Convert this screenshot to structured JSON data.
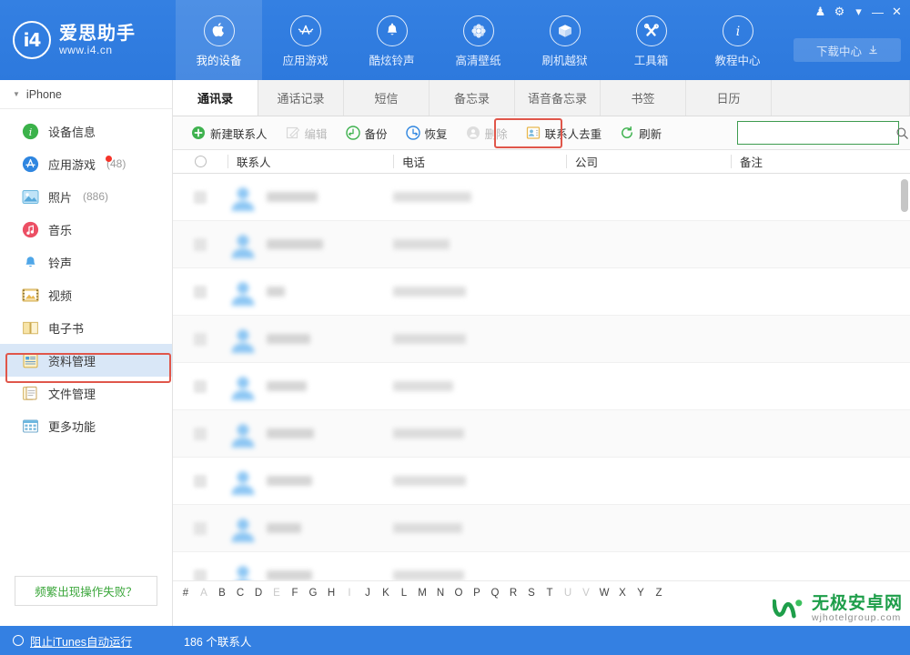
{
  "app": {
    "brand_name": "爱思助手",
    "brand_url": "www.i4.cn",
    "brand_logo_text": "i4"
  },
  "window_controls": [
    {
      "name": "skin-icon",
      "glyph": "♟"
    },
    {
      "name": "gear-icon",
      "glyph": "⚙"
    },
    {
      "name": "chevron-down-icon",
      "glyph": "▾"
    },
    {
      "name": "minimize-icon",
      "glyph": "—"
    },
    {
      "name": "close-icon",
      "glyph": "✕"
    }
  ],
  "header": {
    "download_center_label": "下载中心",
    "nav": [
      {
        "label": "我的设备",
        "icon": "apple-icon",
        "active": true
      },
      {
        "label": "应用游戏",
        "icon": "appstore-icon",
        "active": false
      },
      {
        "label": "酷炫铃声",
        "icon": "bell-icon",
        "active": false
      },
      {
        "label": "高清壁纸",
        "icon": "flower-icon",
        "active": false
      },
      {
        "label": "刷机越狱",
        "icon": "box-icon",
        "active": false
      },
      {
        "label": "工具箱",
        "icon": "tools-icon",
        "active": false
      },
      {
        "label": "教程中心",
        "icon": "info-icon",
        "active": false
      }
    ]
  },
  "sidebar": {
    "device_label": "iPhone",
    "items": [
      {
        "label": "设备信息",
        "icon": "info-circle-icon",
        "color": "#3bb24a",
        "count": "",
        "badge": false,
        "selected": false
      },
      {
        "label": "应用游戏",
        "icon": "appstore-circle-icon",
        "color": "#2f86e0",
        "count": "(48)",
        "badge": true,
        "selected": false
      },
      {
        "label": "照片",
        "icon": "photo-icon",
        "color": "#56b6e8",
        "count": "(886)",
        "badge": false,
        "selected": false
      },
      {
        "label": "音乐",
        "icon": "music-icon",
        "color": "#ec4f64",
        "count": "",
        "badge": false,
        "selected": false
      },
      {
        "label": "铃声",
        "icon": "ringtone-icon",
        "color": "#4fa6e8",
        "count": "",
        "badge": false,
        "selected": false
      },
      {
        "label": "视频",
        "icon": "video-icon",
        "color": "#e8b84f",
        "count": "",
        "badge": false,
        "selected": false
      },
      {
        "label": "电子书",
        "icon": "book-icon",
        "color": "#f0c24a",
        "count": "",
        "badge": false,
        "selected": false
      },
      {
        "label": "资料管理",
        "icon": "data-manage-icon",
        "color": "#f0c24a",
        "count": "",
        "badge": false,
        "selected": true
      },
      {
        "label": "文件管理",
        "icon": "file-manage-icon",
        "color": "#e8c87a",
        "count": "",
        "badge": false,
        "selected": false
      },
      {
        "label": "更多功能",
        "icon": "more-icon",
        "color": "#6fb8e0",
        "count": "",
        "badge": false,
        "selected": false
      }
    ],
    "help_link": "频繁出现操作失败？"
  },
  "main": {
    "tabs": [
      {
        "label": "通讯录",
        "active": true
      },
      {
        "label": "通话记录",
        "active": false
      },
      {
        "label": "短信",
        "active": false
      },
      {
        "label": "备忘录",
        "active": false
      },
      {
        "label": "语音备忘录",
        "active": false
      },
      {
        "label": "书签",
        "active": false
      },
      {
        "label": "日历",
        "active": false
      }
    ],
    "toolbar": [
      {
        "label": "新建联系人",
        "icon": "plus-circle-icon",
        "color": "#3fb24f",
        "disabled": false,
        "highlighted": false
      },
      {
        "label": "编辑",
        "icon": "edit-icon",
        "color": "#bdbdbd",
        "disabled": true,
        "highlighted": false
      },
      {
        "label": "备份",
        "icon": "backup-icon",
        "color": "#3fb24f",
        "disabled": false,
        "highlighted": true
      },
      {
        "label": "恢复",
        "icon": "restore-icon",
        "color": "#2f86e0",
        "disabled": false,
        "highlighted": false
      },
      {
        "label": "删除",
        "icon": "delete-icon",
        "color": "#c6c6c6",
        "disabled": true,
        "highlighted": false
      },
      {
        "label": "联系人去重",
        "icon": "dedupe-icon",
        "color": "#e8b84f",
        "disabled": false,
        "highlighted": false
      },
      {
        "label": "刷新",
        "icon": "refresh-icon",
        "color": "#3fb24f",
        "disabled": false,
        "highlighted": false
      }
    ],
    "search": {
      "value": "",
      "placeholder": "",
      "icon": "search-icon",
      "border_color": "#3d9b4f"
    },
    "table": {
      "columns": [
        "联系人",
        "电话",
        "公司",
        "备注"
      ],
      "select_all_icon": "select-all-circle-icon",
      "rows": [
        {
          "name_w": 56,
          "phone_w": 86,
          "company": "",
          "note": ""
        },
        {
          "name_w": 62,
          "phone_w": 62,
          "company": "",
          "note": ""
        },
        {
          "name_w": 20,
          "phone_w": 80,
          "company": "",
          "note": ""
        },
        {
          "name_w": 48,
          "phone_w": 80,
          "company": "",
          "note": ""
        },
        {
          "name_w": 44,
          "phone_w": 66,
          "company": "",
          "note": ""
        },
        {
          "name_w": 52,
          "phone_w": 78,
          "company": "",
          "note": ""
        },
        {
          "name_w": 50,
          "phone_w": 80,
          "company": "",
          "note": ""
        },
        {
          "name_w": 38,
          "phone_w": 76,
          "company": "",
          "note": ""
        },
        {
          "name_w": 50,
          "phone_w": 78,
          "company": "",
          "note": ""
        }
      ]
    },
    "alphabet": [
      {
        "ch": "#",
        "dim": false
      },
      {
        "ch": "A",
        "dim": true
      },
      {
        "ch": "B",
        "dim": false
      },
      {
        "ch": "C",
        "dim": false
      },
      {
        "ch": "D",
        "dim": false
      },
      {
        "ch": "E",
        "dim": true
      },
      {
        "ch": "F",
        "dim": false
      },
      {
        "ch": "G",
        "dim": false
      },
      {
        "ch": "H",
        "dim": false
      },
      {
        "ch": "I",
        "dim": true
      },
      {
        "ch": "J",
        "dim": false
      },
      {
        "ch": "K",
        "dim": false
      },
      {
        "ch": "L",
        "dim": false
      },
      {
        "ch": "M",
        "dim": false
      },
      {
        "ch": "N",
        "dim": false
      },
      {
        "ch": "O",
        "dim": false
      },
      {
        "ch": "P",
        "dim": false
      },
      {
        "ch": "Q",
        "dim": false
      },
      {
        "ch": "R",
        "dim": false
      },
      {
        "ch": "S",
        "dim": false
      },
      {
        "ch": "T",
        "dim": false
      },
      {
        "ch": "U",
        "dim": true
      },
      {
        "ch": "V",
        "dim": true
      },
      {
        "ch": "W",
        "dim": false
      },
      {
        "ch": "X",
        "dim": false
      },
      {
        "ch": "Y",
        "dim": false
      },
      {
        "ch": "Z",
        "dim": false
      }
    ]
  },
  "statusbar": {
    "itunes_label": "阻止iTunes自动运行",
    "contacts_count": "186 个联系人"
  },
  "watermark": {
    "cn": "无极安卓网",
    "en": "wjhotelgroup.com"
  },
  "colors": {
    "brand_blue": "#3480e2",
    "highlight_red": "#e0564a",
    "search_green": "#3d9b4f",
    "selected_row": "#d9e7f7"
  }
}
